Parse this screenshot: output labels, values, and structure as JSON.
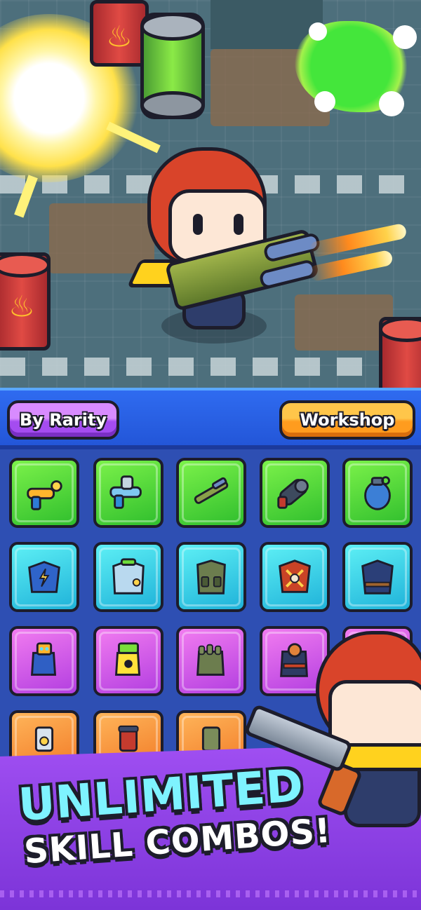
{
  "scene": {
    "description_icons": [
      "explosion-icon",
      "flame-icon",
      "slime-icon"
    ]
  },
  "panel": {
    "sort_button_label": "By Rarity",
    "workshop_button_label": "Workshop",
    "colors": {
      "header": "#2f6bf0",
      "panel": "#2e4fb3",
      "sort_button": "#b55ef5",
      "workshop_button": "#ffab2e",
      "rarity_green": "#3fd13a",
      "rarity_cyan": "#2fc6e4",
      "rarity_purple": "#c94ee8",
      "rarity_orange": "#f5852d"
    },
    "items": [
      {
        "rarity": "green",
        "icon": "ray-gun-icon"
      },
      {
        "rarity": "green",
        "icon": "water-blaster-icon"
      },
      {
        "rarity": "green",
        "icon": "shotgun-icon"
      },
      {
        "rarity": "green",
        "icon": "gatling-gun-icon"
      },
      {
        "rarity": "green",
        "icon": "grenade-icon"
      },
      {
        "rarity": "cyan",
        "icon": "lightning-armor-icon"
      },
      {
        "rarity": "cyan",
        "icon": "hazmat-jacket-icon"
      },
      {
        "rarity": "cyan",
        "icon": "tactical-vest-icon"
      },
      {
        "rarity": "cyan",
        "icon": "spiked-armor-icon"
      },
      {
        "rarity": "cyan",
        "icon": "heavy-armor-icon"
      },
      {
        "rarity": "purple",
        "icon": "tech-glove-icon"
      },
      {
        "rarity": "purple",
        "icon": "hazard-glove-icon"
      },
      {
        "rarity": "purple",
        "icon": "combat-glove-icon"
      },
      {
        "rarity": "purple",
        "icon": "skull-gauntlet-icon"
      },
      {
        "rarity": "purple",
        "icon": "hidden-slot-icon"
      },
      {
        "rarity": "orange",
        "icon": "hazard-boot-icon"
      },
      {
        "rarity": "orange",
        "icon": "red-boot-icon"
      },
      {
        "rarity": "orange",
        "icon": "green-boot-icon"
      }
    ]
  },
  "promo": {
    "line1": "UNLIMITED",
    "line2": "SKILL COMBOS!"
  }
}
